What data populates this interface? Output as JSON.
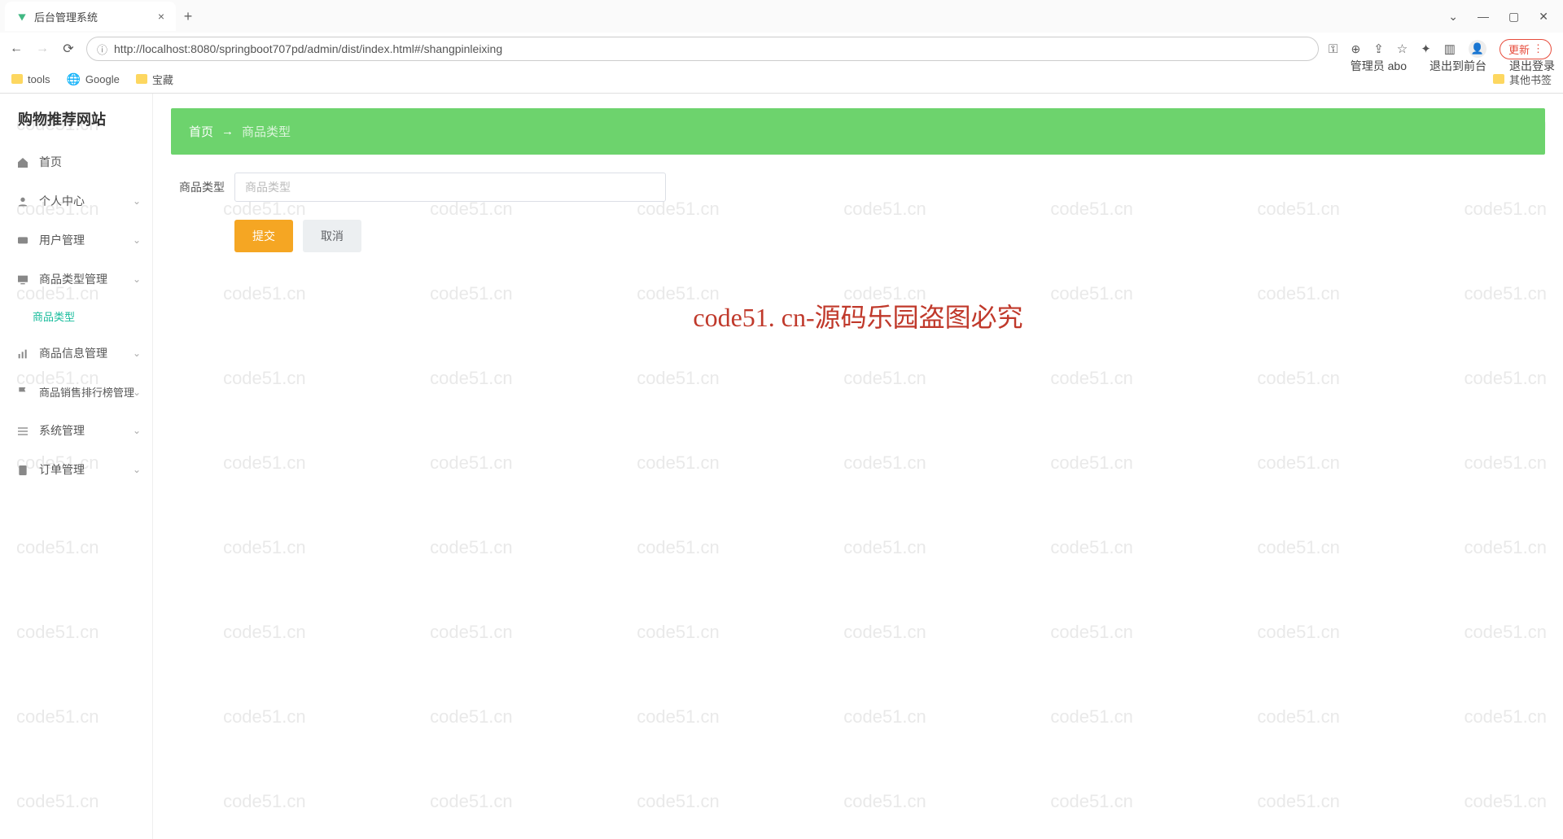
{
  "browser": {
    "tab_title": "后台管理系统",
    "url": "http://localhost:8080/springboot707pd/admin/dist/index.html#/shangpinleixing",
    "update_label": "更新",
    "bookmarks": {
      "tools": "tools",
      "google": "Google",
      "treasure": "宝藏",
      "other": "其他书签"
    }
  },
  "app": {
    "title": "购物推荐网站",
    "user_label": "管理员 abo",
    "exit_front": "退出到前台",
    "logout": "退出登录"
  },
  "sidebar": {
    "items": [
      {
        "label": "首页"
      },
      {
        "label": "个人中心"
      },
      {
        "label": "用户管理"
      },
      {
        "label": "商品类型管理"
      },
      {
        "label": "商品信息管理"
      },
      {
        "label": "商品销售排行榜管理"
      },
      {
        "label": "系统管理"
      },
      {
        "label": "订单管理"
      }
    ],
    "sub_product_type": "商品类型"
  },
  "breadcrumb": {
    "home": "首页",
    "arrow": "→",
    "current": "商品类型"
  },
  "form": {
    "label": "商品类型",
    "placeholder": "商品类型",
    "submit": "提交",
    "cancel": "取消"
  },
  "watermark_main": "code51. cn-源码乐园盗图必究",
  "watermark_small": "code51.cn"
}
